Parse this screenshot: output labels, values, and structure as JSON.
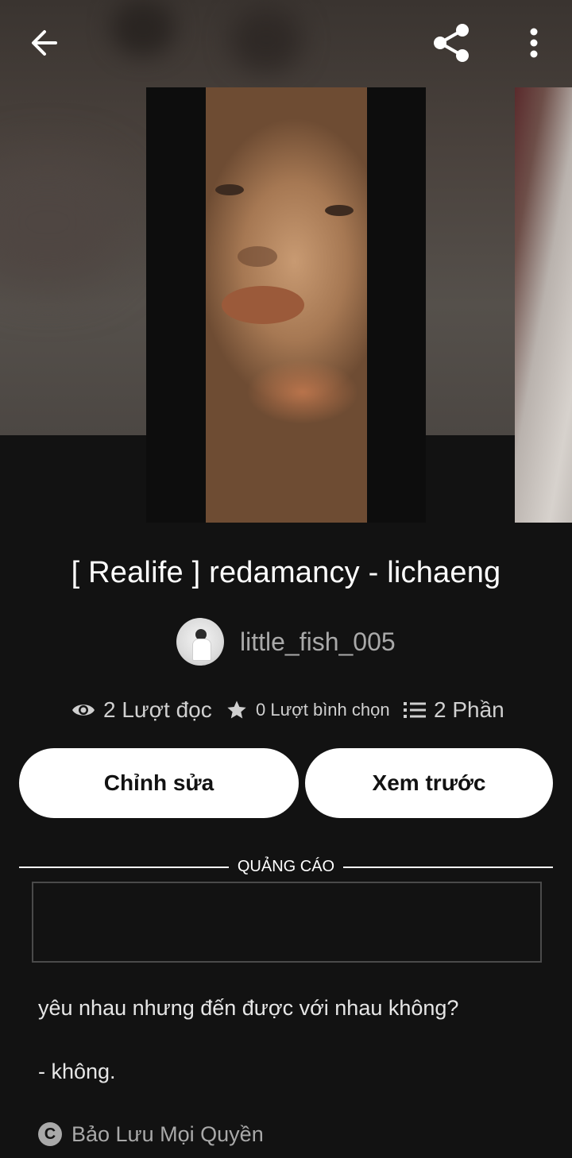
{
  "header": {
    "back_icon": "arrow-left-icon",
    "share_icon": "share-icon",
    "more_icon": "more-vertical-icon"
  },
  "story": {
    "title": "[ Realife ] redamancy - lichaeng",
    "author": "little_fish_005",
    "stats": {
      "reads": "2 Lượt đọc",
      "votes": "0 Lượt bình chọn",
      "parts": "2 Phần"
    }
  },
  "actions": {
    "edit_label": "Chỉnh sửa",
    "preview_label": "Xem trước"
  },
  "ad": {
    "label": "QUẢNG CÁO"
  },
  "description": {
    "line1": "yêu nhau nhưng đến được với nhau không?",
    "line2": "- không."
  },
  "copyright": {
    "text": "Bảo Lưu Mọi Quyền",
    "icon": "copyright-icon"
  }
}
